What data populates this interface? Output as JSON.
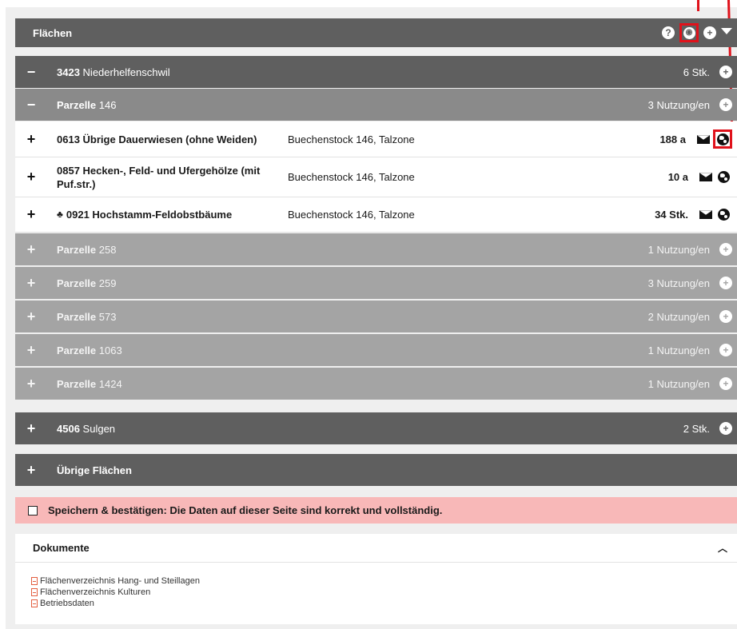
{
  "header": {
    "title": "Flächen"
  },
  "groups": [
    {
      "number": "3423",
      "name": "Niederhelfenschwil",
      "count": "6 Stk."
    },
    {
      "number": "4506",
      "name": "Sulgen",
      "count": "2 Stk."
    },
    {
      "label": "Übrige Flächen"
    }
  ],
  "parcels": [
    {
      "label": "Parzelle",
      "number": "146",
      "usage": "3 Nutzung/en"
    },
    {
      "label": "Parzelle",
      "number": "258",
      "usage": "1 Nutzung/en"
    },
    {
      "label": "Parzelle",
      "number": "259",
      "usage": "3 Nutzung/en"
    },
    {
      "label": "Parzelle",
      "number": "573",
      "usage": "2 Nutzung/en"
    },
    {
      "label": "Parzelle",
      "number": "1063",
      "usage": "1 Nutzung/en"
    },
    {
      "label": "Parzelle",
      "number": "1424",
      "usage": "1 Nutzung/en"
    }
  ],
  "uses": [
    {
      "name": "0613 Übrige Dauerwiesen (ohne Weiden)",
      "location": "Buechenstock 146, Talzone",
      "amount": "188 a"
    },
    {
      "name": "0857 Hecken-, Feld- und Ufergehölze (mit Puf.str.)",
      "location": "Buechenstock 146, Talzone",
      "amount": "10 a"
    },
    {
      "name": "0921 Hochstamm-Feldobstbäume",
      "location": "Buechenstock 146, Talzone",
      "amount": "34 Stk."
    }
  ],
  "confirm": {
    "label": "Speichern & bestätigen: Die Daten auf dieser Seite sind korrekt und vollständig."
  },
  "documents": {
    "title": "Dokumente",
    "items": [
      "Flächenverzeichnis Hang- und Steillagen",
      "Flächenverzeichnis Kulturen",
      "Betriebsdaten"
    ]
  },
  "colors": {
    "highlight": "#e0121b",
    "confirm_bg": "#f8b8b8",
    "header_bg": "#5f5f5f"
  },
  "icons": {
    "header": [
      "help-icon",
      "globe-icon",
      "add-icon",
      "filter-icon"
    ],
    "use_row": [
      "envelope-icon",
      "globe-icon"
    ]
  }
}
